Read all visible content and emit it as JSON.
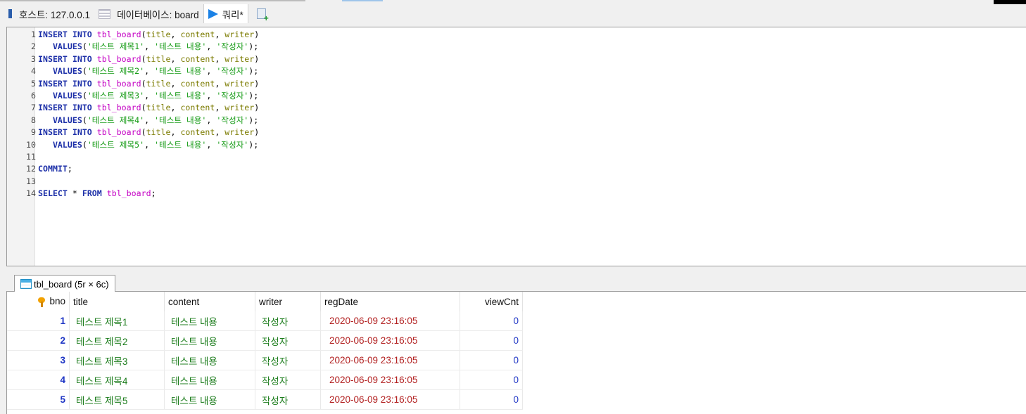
{
  "tabs": {
    "host": "호스트: 127.0.0.1",
    "database": "데이터베이스: board",
    "query": "쿼리*"
  },
  "editor": {
    "lines": [
      {
        "n": "1",
        "t": [
          [
            "kw",
            "INSERT INTO "
          ],
          [
            "tb",
            "tbl_board"
          ],
          [
            "pn",
            "("
          ],
          [
            "col",
            "title"
          ],
          [
            "pn",
            ", "
          ],
          [
            "col",
            "content"
          ],
          [
            "pn",
            ", "
          ],
          [
            "col",
            "writer"
          ],
          [
            "pn",
            ")"
          ]
        ]
      },
      {
        "n": "2",
        "t": [
          [
            "pn",
            "   "
          ],
          [
            "kw",
            "VALUES"
          ],
          [
            "pn",
            "("
          ],
          [
            "str",
            "'테스트 제목1'"
          ],
          [
            "pn",
            ", "
          ],
          [
            "str",
            "'테스트 내용'"
          ],
          [
            "pn",
            ", "
          ],
          [
            "str",
            "'작성자'"
          ],
          [
            "pn",
            ");"
          ]
        ]
      },
      {
        "n": "3",
        "t": [
          [
            "kw",
            "INSERT INTO "
          ],
          [
            "tb",
            "tbl_board"
          ],
          [
            "pn",
            "("
          ],
          [
            "col",
            "title"
          ],
          [
            "pn",
            ", "
          ],
          [
            "col",
            "content"
          ],
          [
            "pn",
            ", "
          ],
          [
            "col",
            "writer"
          ],
          [
            "pn",
            ")"
          ]
        ]
      },
      {
        "n": "4",
        "t": [
          [
            "pn",
            "   "
          ],
          [
            "kw",
            "VALUES"
          ],
          [
            "pn",
            "("
          ],
          [
            "str",
            "'테스트 제목2'"
          ],
          [
            "pn",
            ", "
          ],
          [
            "str",
            "'테스트 내용'"
          ],
          [
            "pn",
            ", "
          ],
          [
            "str",
            "'작성자'"
          ],
          [
            "pn",
            ");"
          ]
        ]
      },
      {
        "n": "5",
        "t": [
          [
            "kw",
            "INSERT INTO "
          ],
          [
            "tb",
            "tbl_board"
          ],
          [
            "pn",
            "("
          ],
          [
            "col",
            "title"
          ],
          [
            "pn",
            ", "
          ],
          [
            "col",
            "content"
          ],
          [
            "pn",
            ", "
          ],
          [
            "col",
            "writer"
          ],
          [
            "pn",
            ")"
          ]
        ]
      },
      {
        "n": "6",
        "t": [
          [
            "pn",
            "   "
          ],
          [
            "kw",
            "VALUES"
          ],
          [
            "pn",
            "("
          ],
          [
            "str",
            "'테스트 제목3'"
          ],
          [
            "pn",
            ", "
          ],
          [
            "str",
            "'테스트 내용'"
          ],
          [
            "pn",
            ", "
          ],
          [
            "str",
            "'작성자'"
          ],
          [
            "pn",
            ");"
          ]
        ]
      },
      {
        "n": "7",
        "t": [
          [
            "kw",
            "INSERT INTO "
          ],
          [
            "tb",
            "tbl_board"
          ],
          [
            "pn",
            "("
          ],
          [
            "col",
            "title"
          ],
          [
            "pn",
            ", "
          ],
          [
            "col",
            "content"
          ],
          [
            "pn",
            ", "
          ],
          [
            "col",
            "writer"
          ],
          [
            "pn",
            ")"
          ]
        ]
      },
      {
        "n": "8",
        "t": [
          [
            "pn",
            "   "
          ],
          [
            "kw",
            "VALUES"
          ],
          [
            "pn",
            "("
          ],
          [
            "str",
            "'테스트 제목4'"
          ],
          [
            "pn",
            ", "
          ],
          [
            "str",
            "'테스트 내용'"
          ],
          [
            "pn",
            ", "
          ],
          [
            "str",
            "'작성자'"
          ],
          [
            "pn",
            ");"
          ]
        ]
      },
      {
        "n": "9",
        "t": [
          [
            "kw",
            "INSERT INTO "
          ],
          [
            "tb",
            "tbl_board"
          ],
          [
            "pn",
            "("
          ],
          [
            "col",
            "title"
          ],
          [
            "pn",
            ", "
          ],
          [
            "col",
            "content"
          ],
          [
            "pn",
            ", "
          ],
          [
            "col",
            "writer"
          ],
          [
            "pn",
            ")"
          ]
        ]
      },
      {
        "n": "10",
        "t": [
          [
            "pn",
            "   "
          ],
          [
            "kw",
            "VALUES"
          ],
          [
            "pn",
            "("
          ],
          [
            "str",
            "'테스트 제목5'"
          ],
          [
            "pn",
            ", "
          ],
          [
            "str",
            "'테스트 내용'"
          ],
          [
            "pn",
            ", "
          ],
          [
            "str",
            "'작성자'"
          ],
          [
            "pn",
            ");"
          ]
        ]
      },
      {
        "n": "11",
        "t": []
      },
      {
        "n": "12",
        "t": [
          [
            "kw",
            "COMMIT"
          ],
          [
            "pn",
            ";"
          ]
        ]
      },
      {
        "n": "13",
        "t": []
      },
      {
        "n": "14",
        "t": [
          [
            "kw",
            "SELECT"
          ],
          [
            "pn",
            " * "
          ],
          [
            "kw",
            "FROM "
          ],
          [
            "tb",
            "tbl_board"
          ],
          [
            "pn",
            ";"
          ]
        ]
      }
    ]
  },
  "result": {
    "tab_label": "tbl_board (5r × 6c)",
    "columns": [
      "bno",
      "title",
      "content",
      "writer",
      "regDate",
      "viewCnt"
    ],
    "rows": [
      [
        "1",
        "테스트 제목1",
        "테스트 내용",
        "작성자",
        "2020-06-09 23:16:05",
        "0"
      ],
      [
        "2",
        "테스트 제목2",
        "테스트 내용",
        "작성자",
        "2020-06-09 23:16:05",
        "0"
      ],
      [
        "3",
        "테스트 제목3",
        "테스트 내용",
        "작성자",
        "2020-06-09 23:16:05",
        "0"
      ],
      [
        "4",
        "테스트 제목4",
        "테스트 내용",
        "작성자",
        "2020-06-09 23:16:05",
        "0"
      ],
      [
        "5",
        "테스트 제목5",
        "테스트 내용",
        "작성자",
        "2020-06-09 23:16:05",
        "0"
      ]
    ]
  }
}
